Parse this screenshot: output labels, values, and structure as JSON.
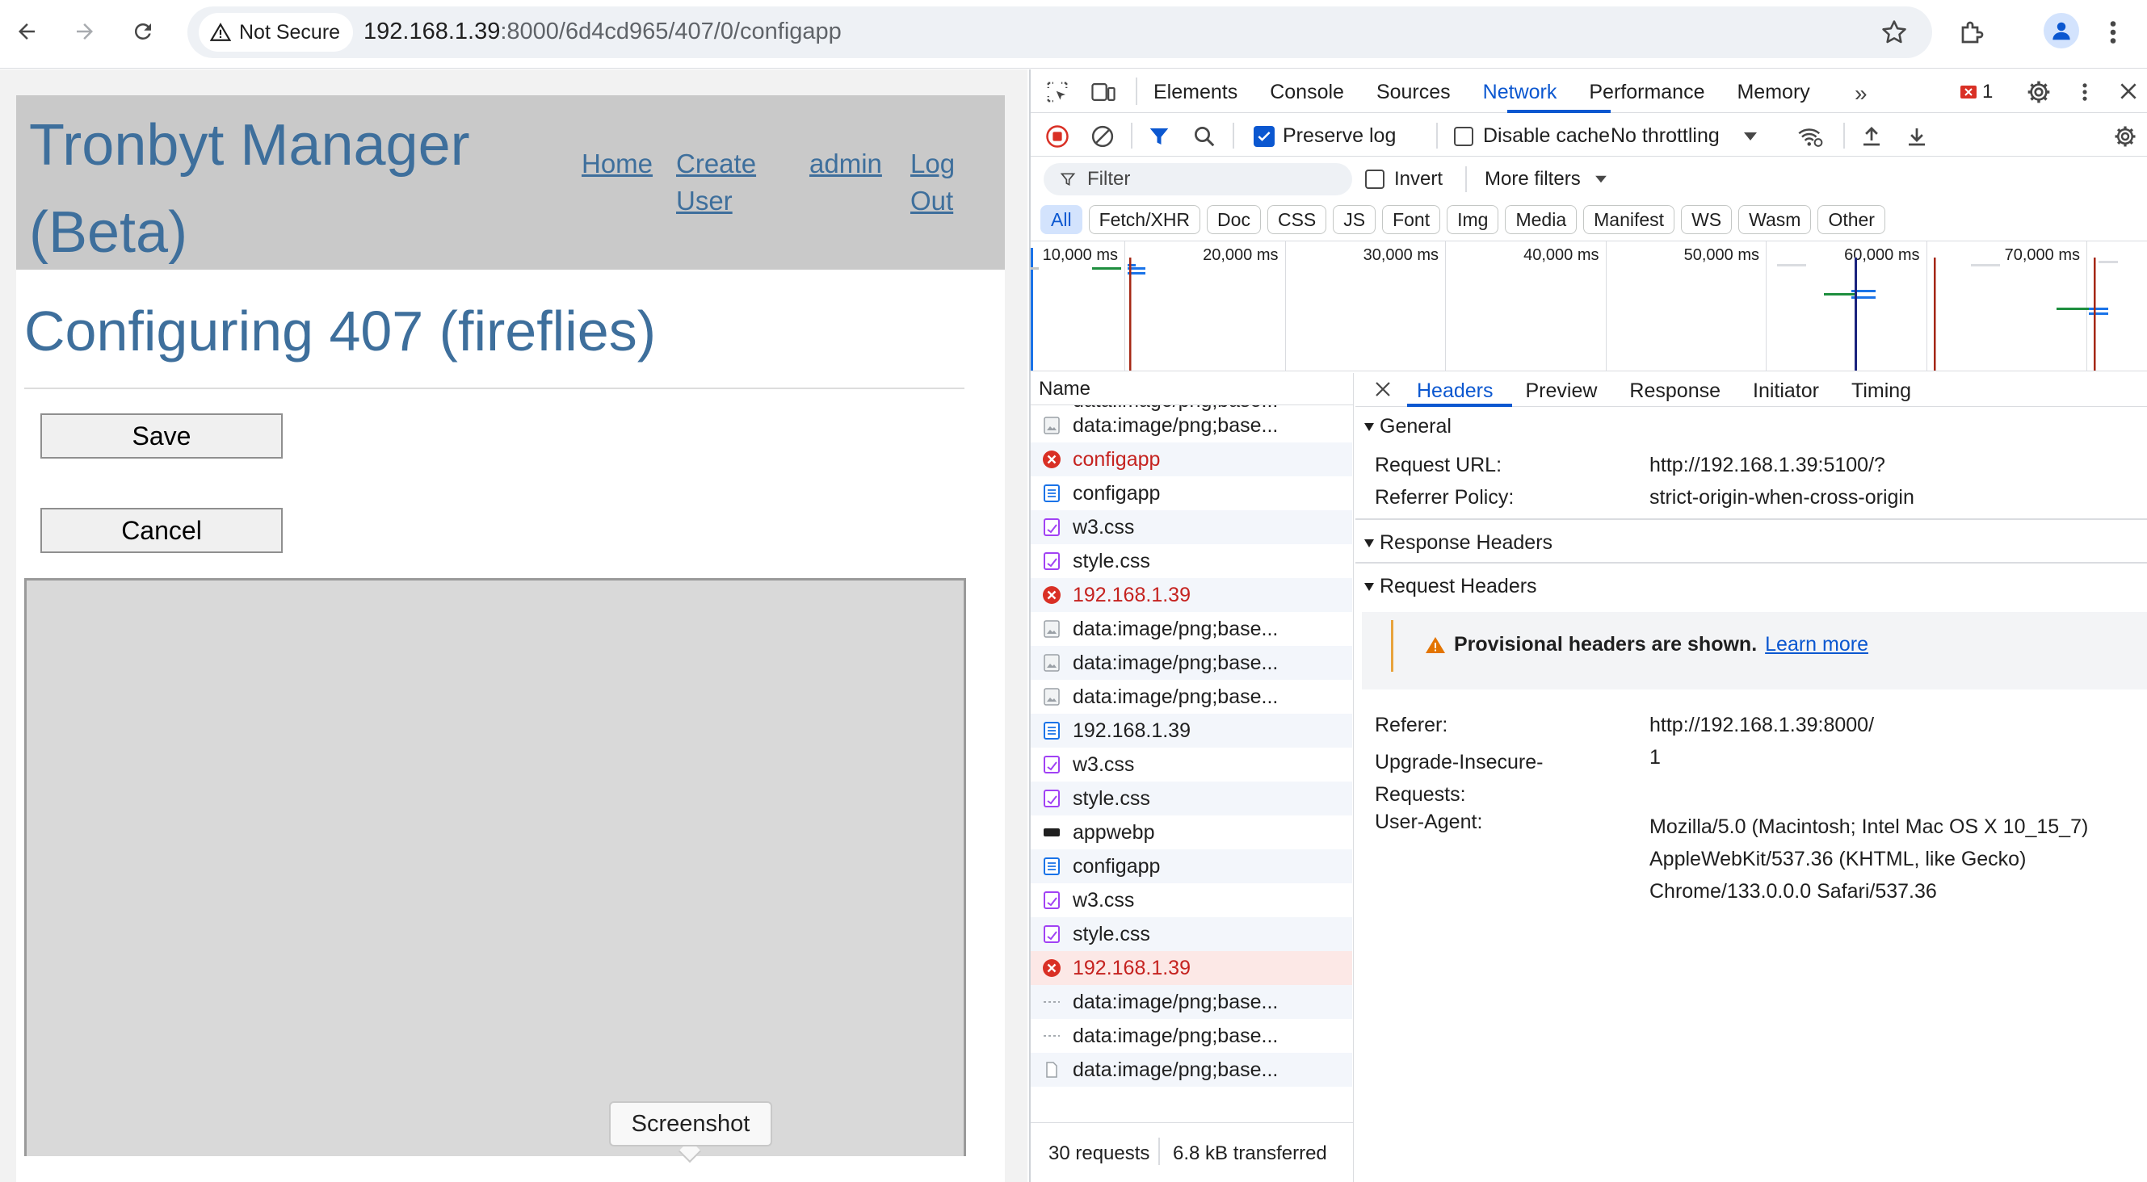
{
  "browser": {
    "security_label": "Not Secure",
    "url_host": "192.168.1.39",
    "url_path": ":8000/6d4cd965/407/0/configapp"
  },
  "page": {
    "brand": "Tronbyt Manager (Beta)",
    "nav": {
      "home": "Home",
      "create_user_line1": "Create",
      "create_user_line2": "User",
      "admin": "admin",
      "logout_line1": "Log",
      "logout_line2": "Out"
    },
    "title": "Configuring 407 (fireflies)",
    "save_label": "Save",
    "cancel_label": "Cancel",
    "tooltip": "Screenshot"
  },
  "devtools": {
    "tabs": [
      "Elements",
      "Console",
      "Sources",
      "Network",
      "Performance",
      "Memory"
    ],
    "active_tab": "Network",
    "error_count": "1",
    "toolbar": {
      "preserve_log": "Preserve log",
      "disable_cache": "Disable cache",
      "throttling": "No throttling"
    },
    "filter": {
      "placeholder": "Filter",
      "invert": "Invert",
      "more_filters": "More filters"
    },
    "type_filters": [
      "All",
      "Fetch/XHR",
      "Doc",
      "CSS",
      "JS",
      "Font",
      "Img",
      "Media",
      "Manifest",
      "WS",
      "Wasm",
      "Other"
    ],
    "timeline_ticks": [
      "10,000 ms",
      "20,000 ms",
      "30,000 ms",
      "40,000 ms",
      "50,000 ms",
      "60,000 ms",
      "70,000 ms"
    ],
    "name_header": "Name",
    "requests": [
      {
        "name": "data:image/png;base...",
        "type": "img",
        "status": "ok"
      },
      {
        "name": "data:image/png;base...",
        "type": "img",
        "status": "ok"
      },
      {
        "name": "configapp",
        "type": "doc",
        "status": "error"
      },
      {
        "name": "configapp",
        "type": "doc",
        "status": "ok"
      },
      {
        "name": "w3.css",
        "type": "css",
        "status": "ok"
      },
      {
        "name": "style.css",
        "type": "css",
        "status": "ok"
      },
      {
        "name": "192.168.1.39",
        "type": "doc",
        "status": "error"
      },
      {
        "name": "data:image/png;base...",
        "type": "img",
        "status": "ok"
      },
      {
        "name": "data:image/png;base...",
        "type": "img",
        "status": "ok"
      },
      {
        "name": "data:image/png;base...",
        "type": "img",
        "status": "ok"
      },
      {
        "name": "192.168.1.39",
        "type": "doc",
        "status": "ok"
      },
      {
        "name": "w3.css",
        "type": "css",
        "status": "ok"
      },
      {
        "name": "style.css",
        "type": "css",
        "status": "ok"
      },
      {
        "name": "appwebp",
        "type": "media",
        "status": "ok"
      },
      {
        "name": "configapp",
        "type": "doc",
        "status": "ok"
      },
      {
        "name": "w3.css",
        "type": "css",
        "status": "ok"
      },
      {
        "name": "style.css",
        "type": "css",
        "status": "ok"
      },
      {
        "name": "192.168.1.39",
        "type": "doc",
        "status": "error-selected"
      },
      {
        "name": "data:image/png;base...",
        "type": "dash",
        "status": "ok"
      },
      {
        "name": "data:image/png;base...",
        "type": "dash",
        "status": "ok"
      },
      {
        "name": "data:image/png;base...",
        "type": "file",
        "status": "ok"
      }
    ],
    "status_bar": {
      "requests": "30 requests",
      "transferred": "6.8 kB transferred"
    },
    "detail_tabs": [
      "Headers",
      "Preview",
      "Response",
      "Initiator",
      "Timing"
    ],
    "general_section": "General",
    "general": [
      {
        "key": "Request URL:",
        "value": "http://192.168.1.39:5100/?"
      },
      {
        "key": "Referrer Policy:",
        "value": "strict-origin-when-cross-origin"
      }
    ],
    "response_headers_section": "Response Headers",
    "request_headers_section": "Request Headers",
    "provisional_warning": "Provisional headers are shown.",
    "learn_more": "Learn more",
    "request_headers": {
      "referer_key": "Referer:",
      "referer_value": "http://192.168.1.39:8000/",
      "upgrade_key_line1": "Upgrade-Insecure-",
      "upgrade_key_line2": "Requests:",
      "upgrade_value": "1",
      "ua_key": "User-Agent:",
      "ua_value_line1": "Mozilla/5.0 (Macintosh; Intel Mac OS X 10_15_7)",
      "ua_value_line2": "AppleWebKit/537.36 (KHTML, like Gecko)",
      "ua_value_line3": "Chrome/133.0.0.0 Safari/537.36"
    }
  }
}
